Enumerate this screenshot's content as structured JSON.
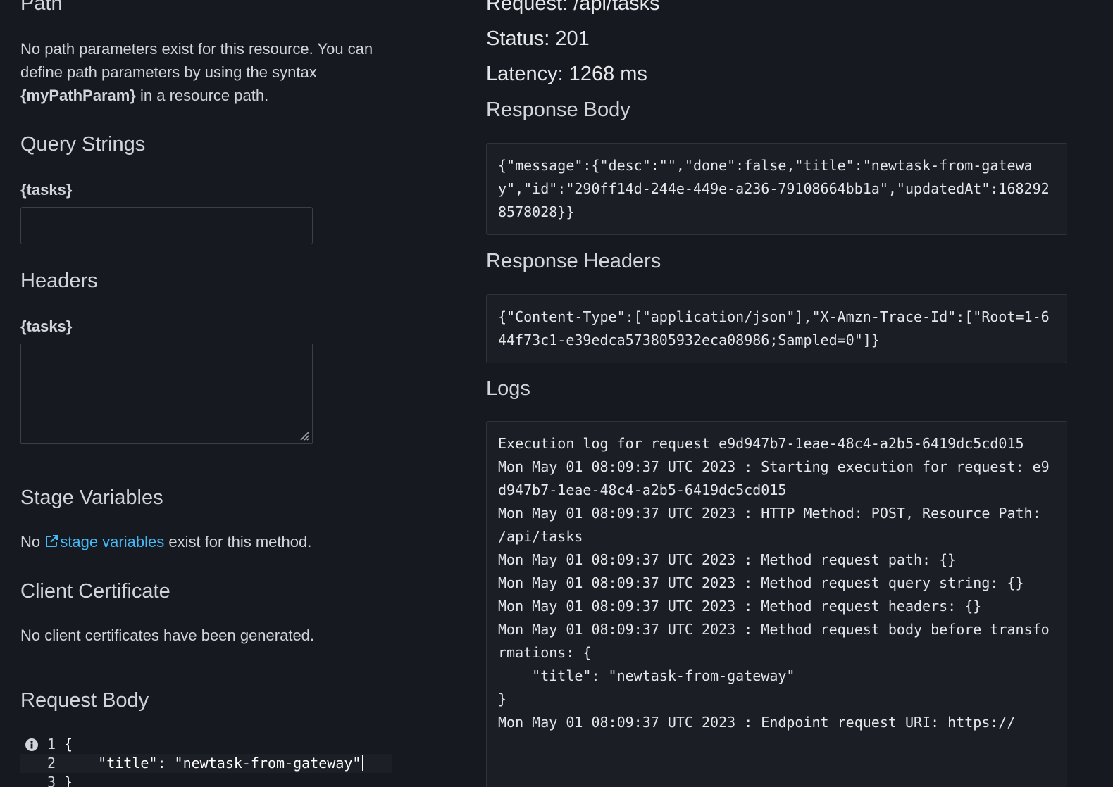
{
  "left": {
    "path_heading": "Path",
    "path_desc_1": "No path parameters exist for this resource. You can define path parameters by using the syntax ",
    "path_desc_bold": "{myPathParam}",
    "path_desc_2": " in a resource path.",
    "query_heading": "Query Strings",
    "query_param_label": "{tasks}",
    "query_input_value": "",
    "headers_heading": "Headers",
    "headers_param_label": "{tasks}",
    "headers_textarea_value": "",
    "stage_heading": "Stage Variables",
    "stage_desc_prefix": "No ",
    "stage_link": "stage variables",
    "stage_desc_suffix": " exist for this method.",
    "cert_heading": "Client Certificate",
    "cert_desc": "No client certificates have been generated.",
    "body_heading": "Request Body",
    "editor_lines": [
      {
        "num": "1",
        "text": "{"
      },
      {
        "num": "2",
        "text": "    \"title\": \"newtask-from-gateway\""
      },
      {
        "num": "3",
        "text": "}"
      }
    ]
  },
  "right": {
    "request": "Request: /api/tasks",
    "status": "Status: 201",
    "latency": "Latency: 1268 ms",
    "response_body_heading": "Response Body",
    "response_body": "{\"message\":{\"desc\":\"\",\"done\":false,\"title\":\"newtask-from-gateway\",\"id\":\"290ff14d-244e-449e-a236-79108664bb1a\",\"updatedAt\":1682928578028}}",
    "response_headers_heading": "Response Headers",
    "response_headers": "{\"Content-Type\":[\"application/json\"],\"X-Amzn-Trace-Id\":[\"Root=1-644f73c1-e39edca573805932eca08986;Sampled=0\"]}",
    "logs_heading": "Logs",
    "logs": "Execution log for request e9d947b7-1eae-48c4-a2b5-6419dc5cd015\nMon May 01 08:09:37 UTC 2023 : Starting execution for request: e9d947b7-1eae-48c4-a2b5-6419dc5cd015\nMon May 01 08:09:37 UTC 2023 : HTTP Method: POST, Resource Path: /api/tasks\nMon May 01 08:09:37 UTC 2023 : Method request path: {}\nMon May 01 08:09:37 UTC 2023 : Method request query string: {}\nMon May 01 08:09:37 UTC 2023 : Method request headers: {}\nMon May 01 08:09:37 UTC 2023 : Method request body before transformations: {\n    \"title\": \"newtask-from-gateway\"\n}\nMon May 01 08:09:37 UTC 2023 : Endpoint request URI: https://"
  },
  "colors": {
    "background": "#16191f",
    "text": "#d1d5db",
    "link": "#44b9f5",
    "code_box_bg": "#1b1f25",
    "border": "#3b4046"
  }
}
